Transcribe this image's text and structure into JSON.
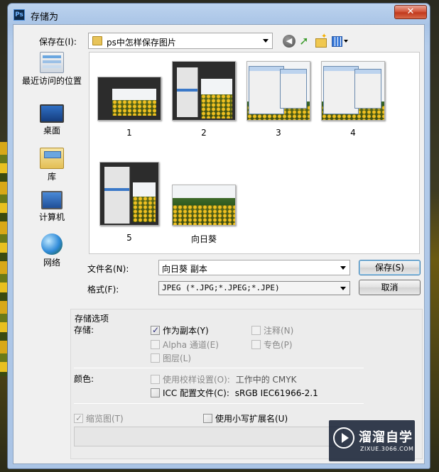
{
  "window": {
    "title": "存储为",
    "app_icon": "Ps",
    "close_glyph": "✕"
  },
  "location": {
    "label": "保存在(I):",
    "path": "ps中怎样保存图片"
  },
  "nav_icons": [
    "back-icon",
    "up-folder-icon",
    "new-folder-icon",
    "views-menu-icon"
  ],
  "places": [
    {
      "label": "最近访问的位置",
      "icon": "recent-places-icon"
    },
    {
      "label": "桌面",
      "icon": "desktop-icon"
    },
    {
      "label": "库",
      "icon": "library-icon"
    },
    {
      "label": "计算机",
      "icon": "computer-icon"
    },
    {
      "label": "网络",
      "icon": "network-icon"
    }
  ],
  "files": [
    {
      "name": "1"
    },
    {
      "name": "2"
    },
    {
      "name": "3"
    },
    {
      "name": "4"
    },
    {
      "name": "5"
    },
    {
      "name": "向日葵"
    }
  ],
  "form": {
    "filename_label": "文件名(N):",
    "filename_value": "向日葵 副本",
    "format_label": "格式(F):",
    "format_value": "JPEG (*.JPG;*.JPEG;*.JPE)",
    "save_button": "保存(S)",
    "cancel_button": "取消"
  },
  "options": {
    "group_title": "存储选项",
    "store_label": "存储:",
    "as_copy": {
      "label": "作为副本(Y)",
      "checked": true,
      "enabled": true
    },
    "notes": {
      "label": "注释(N)",
      "checked": false,
      "enabled": false
    },
    "alpha": {
      "label": "Alpha 通道(E)",
      "checked": false,
      "enabled": false
    },
    "spot": {
      "label": "专色(P)",
      "checked": false,
      "enabled": false
    },
    "layers": {
      "label": "图层(L)",
      "checked": false,
      "enabled": false
    },
    "color_label": "颜色:",
    "proof": {
      "label": "使用校样设置(O):",
      "suffix": "工作中的 CMYK",
      "checked": false,
      "enabled": false
    },
    "icc": {
      "label": "ICC 配置文件(C):",
      "suffix": "sRGB IEC61966-2.1",
      "checked": false,
      "enabled": true
    },
    "thumbnail": {
      "label": "缩览图(T)",
      "checked": true,
      "enabled": false
    },
    "lowercase_ext": {
      "label": "使用小写扩展名(U)",
      "checked": false,
      "enabled": true
    }
  },
  "watermark": {
    "title": "溜溜自学",
    "subtitle": "ZIXUE.3066.COM"
  }
}
